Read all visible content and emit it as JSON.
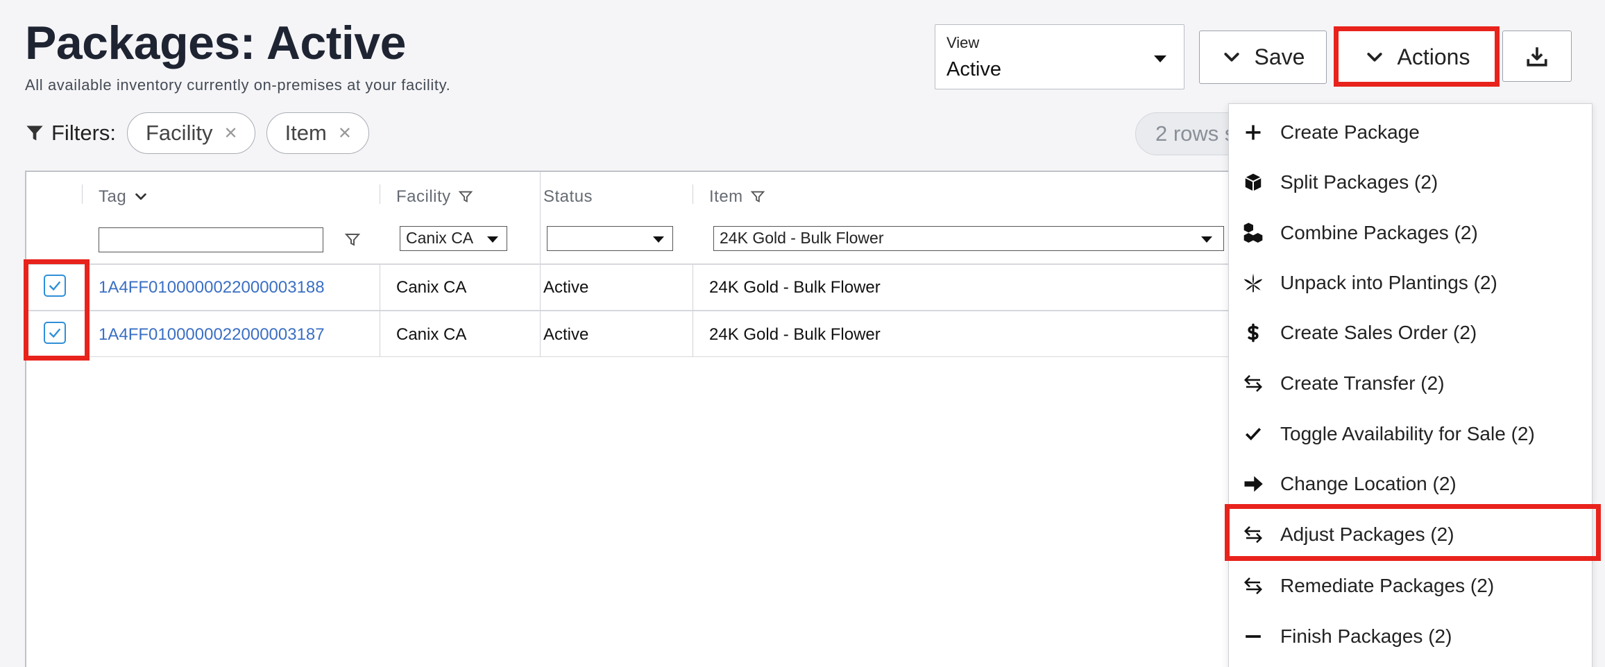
{
  "header": {
    "title": "Packages: Active",
    "subtitle": "All available inventory currently on-premises at your facility."
  },
  "view": {
    "label": "View",
    "value": "Active"
  },
  "toolbar": {
    "save_label": "Save",
    "actions_label": "Actions",
    "download_icon": "download-icon"
  },
  "filters": {
    "label": "Filters:",
    "chips": [
      "Facility",
      "Item"
    ],
    "rows_selected": "2 rows s"
  },
  "table": {
    "columns": {
      "tag": "Tag",
      "facility": "Facility",
      "status": "Status",
      "item": "Item"
    },
    "filters": {
      "tag": "",
      "facility": "Canix CA",
      "status": "",
      "item": "24K Gold - Bulk Flower"
    },
    "rows": [
      {
        "checked": true,
        "tag": "1A4FF0100000022000003188",
        "facility": "Canix CA",
        "status": "Active",
        "item": "24K Gold - Bulk Flower"
      },
      {
        "checked": true,
        "tag": "1A4FF0100000022000003187",
        "facility": "Canix CA",
        "status": "Active",
        "item": "24K Gold - Bulk Flower"
      }
    ]
  },
  "actions_menu": {
    "items": [
      {
        "label": "Create Package",
        "icon": "plus-icon"
      },
      {
        "label": "Split Packages (2)",
        "icon": "box-icon"
      },
      {
        "label": "Combine Packages (2)",
        "icon": "boxes-icon"
      },
      {
        "label": "Unpack into Plantings (2)",
        "icon": "cannabis-leaf-icon"
      },
      {
        "label": "Create Sales Order (2)",
        "icon": "dollar-icon"
      },
      {
        "label": "Create Transfer (2)",
        "icon": "exchange-arrows-icon"
      },
      {
        "label": "Toggle Availability for Sale (2)",
        "icon": "check-icon"
      },
      {
        "label": "Change Location (2)",
        "icon": "arrow-right-icon"
      },
      {
        "label": "Adjust Packages (2)",
        "icon": "exchange-arrows-icon"
      },
      {
        "label": "Remediate Packages (2)",
        "icon": "exchange-arrows-icon"
      },
      {
        "label": "Finish Packages (2)",
        "icon": "minus-icon"
      }
    ]
  },
  "colors": {
    "highlight": "#e8231c",
    "link": "#3a6fc4",
    "checkbox": "#2f8fd8",
    "title": "#1f2433"
  }
}
